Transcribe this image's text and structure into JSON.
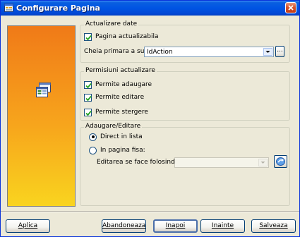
{
  "window": {
    "title": "Configurare Pagina"
  },
  "groups": {
    "actualizare": {
      "label": "Actualizare date",
      "pagina_actualizabila": {
        "label": "Pagina actualizabila",
        "checked": true
      },
      "cheia_label": "Cheia primara a sursei:",
      "cheia_value": "IdAction",
      "browse_label": "..."
    },
    "permisiuni": {
      "label": "Permisiuni actualizare",
      "items": [
        {
          "label": "Permite adaugare",
          "checked": true
        },
        {
          "label": "Permite editare",
          "checked": true
        },
        {
          "label": "Permite stergere",
          "checked": true
        }
      ]
    },
    "adaugare": {
      "label": "Adaugare/Editare",
      "options": [
        {
          "label": "Direct in lista",
          "selected": true
        },
        {
          "label": "In pagina fisa:",
          "selected": false
        }
      ],
      "fisa_label": "Editarea se face folosind fisa:",
      "fisa_value": ""
    }
  },
  "buttons": {
    "aplica": "Aplica",
    "abandoneaza": "Abandoneaza",
    "inapoi": "Inapoi",
    "inainte": "Inainte",
    "salveaza": "Salveaza"
  },
  "icons": {
    "window": "window-icon",
    "close": "close-icon",
    "side": "form-config-icon",
    "edit_form": "edit-form-icon"
  },
  "colors": {
    "titlebar": "#0054e3",
    "accent_orange": "#f7a51c",
    "dialog_bg": "#ece9d8"
  }
}
